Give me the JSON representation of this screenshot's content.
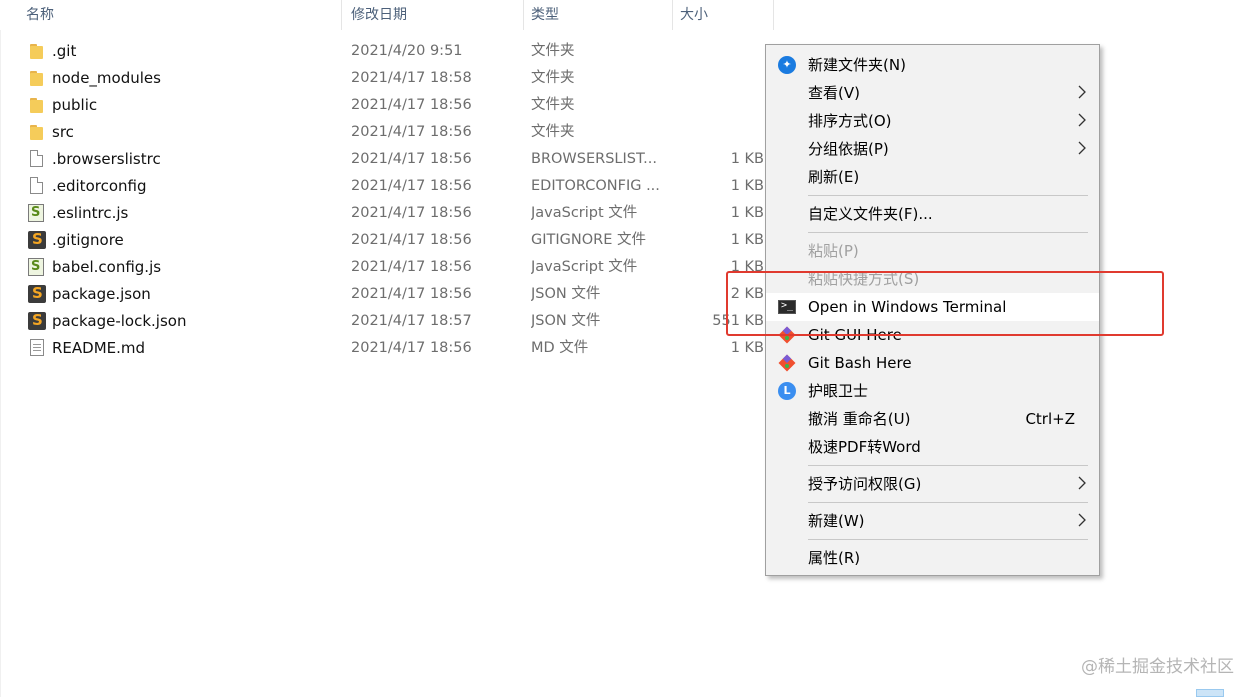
{
  "columns": {
    "name": "名称",
    "date": "修改日期",
    "type": "类型",
    "size": "大小"
  },
  "sort_indicator": "^",
  "files": [
    {
      "name": ".git",
      "date": "2021/4/20 9:51",
      "type": "文件夹",
      "size": "",
      "icon": "folder-icon"
    },
    {
      "name": "node_modules",
      "date": "2021/4/17 18:58",
      "type": "文件夹",
      "size": "",
      "icon": "folder-icon"
    },
    {
      "name": "public",
      "date": "2021/4/17 18:56",
      "type": "文件夹",
      "size": "",
      "icon": "folder-icon"
    },
    {
      "name": "src",
      "date": "2021/4/17 18:56",
      "type": "文件夹",
      "size": "",
      "icon": "folder-icon"
    },
    {
      "name": ".browserslistrc",
      "date": "2021/4/17 18:56",
      "type": "BROWSERSLIST...",
      "size": "1 KB",
      "icon": "file-icon"
    },
    {
      "name": ".editorconfig",
      "date": "2021/4/17 18:56",
      "type": "EDITORCONFIG ...",
      "size": "1 KB",
      "icon": "file-icon"
    },
    {
      "name": ".eslintrc.js",
      "date": "2021/4/17 18:56",
      "type": "JavaScript 文件",
      "size": "1 KB",
      "icon": "js-file-icon"
    },
    {
      "name": ".gitignore",
      "date": "2021/4/17 18:56",
      "type": "GITIGNORE 文件",
      "size": "1 KB",
      "icon": "sublime-file-icon"
    },
    {
      "name": "babel.config.js",
      "date": "2021/4/17 18:56",
      "type": "JavaScript 文件",
      "size": "1 KB",
      "icon": "js-file-icon"
    },
    {
      "name": "package.json",
      "date": "2021/4/17 18:56",
      "type": "JSON 文件",
      "size": "2 KB",
      "icon": "sublime-file-icon"
    },
    {
      "name": "package-lock.json",
      "date": "2021/4/17 18:57",
      "type": "JSON 文件",
      "size": "551 KB",
      "icon": "sublime-file-icon"
    },
    {
      "name": "README.md",
      "date": "2021/4/17 18:56",
      "type": "MD 文件",
      "size": "1 KB",
      "icon": "text-file-icon"
    }
  ],
  "context_menu": {
    "new_folder": "新建文件夹(N)",
    "view": "查看(V)",
    "sort_by": "排序方式(O)",
    "group_by": "分组依据(P)",
    "refresh": "刷新(E)",
    "customize_folder": "自定义文件夹(F)...",
    "paste": "粘贴(P)",
    "paste_shortcut": "粘贴快捷方式(S)",
    "open_terminal": "Open in Windows Terminal",
    "git_gui": "Git GUI Here",
    "git_bash": "Git Bash Here",
    "eye_guard": "护眼卫士",
    "undo_rename": "撤消 重命名(U)",
    "undo_shortcut": "Ctrl+Z",
    "pdf_to_word": "极速PDF转Word",
    "grant_access": "授予访问权限(G)",
    "new": "新建(W)",
    "properties": "属性(R)"
  },
  "icon_glyphs": {
    "terminal": ">_",
    "eye_guard": "L",
    "js": "S",
    "sublime": "S"
  },
  "watermark": "@稀土掘金技术社区",
  "colors": {
    "highlight_border": "#e03a2f",
    "menu_background": "#f2f2f2",
    "header_text": "#4c607a"
  }
}
